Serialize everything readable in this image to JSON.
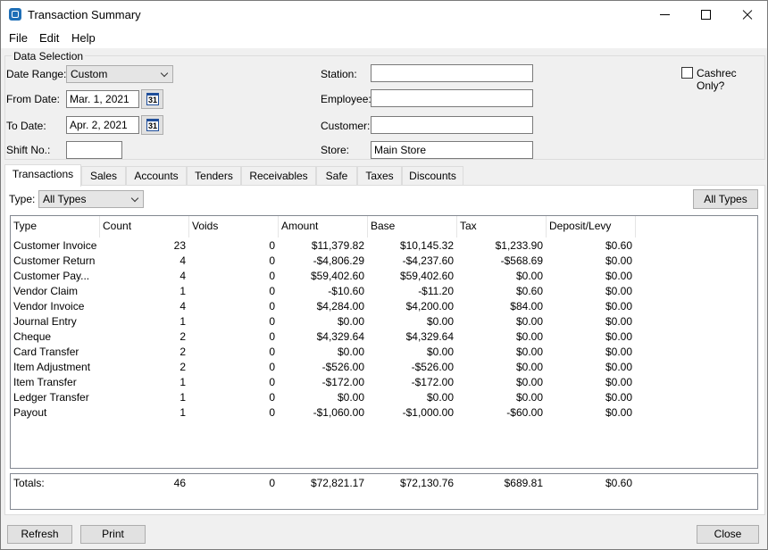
{
  "window": {
    "title": "Transaction Summary"
  },
  "menu": {
    "file": "File",
    "edit": "Edit",
    "help": "Help"
  },
  "data_selection": {
    "title": "Data Selection",
    "date_range_label": "Date Range:",
    "date_range_value": "Custom",
    "from_date_label": "From Date:",
    "from_date_value": "Mar. 1, 2021",
    "to_date_label": "To Date:",
    "to_date_value": "Apr. 2, 2021",
    "shift_label": "Shift No.:",
    "shift_value": "",
    "station_label": "Station:",
    "station_value": "",
    "employee_label": "Employee:",
    "employee_value": "",
    "customer_label": "Customer:",
    "customer_value": "",
    "store_label": "Store:",
    "store_value": "Main Store",
    "cashrec_label": "Cashrec Only?",
    "calendar_glyph": "31"
  },
  "tabs": [
    "Transactions",
    "Sales",
    "Accounts",
    "Tenders",
    "Receivables",
    "Safe",
    "Taxes",
    "Discounts"
  ],
  "filter": {
    "type_label": "Type:",
    "type_value": "All Types",
    "all_types_button": "All Types"
  },
  "grid": {
    "headers": [
      "Type",
      "Count",
      "Voids",
      "Amount",
      "Base",
      "Tax",
      "Deposit/Levy"
    ],
    "rows": [
      [
        "Customer Invoice",
        "23",
        "0",
        "$11,379.82",
        "$10,145.32",
        "$1,233.90",
        "$0.60"
      ],
      [
        "Customer Return",
        "4",
        "0",
        "-$4,806.29",
        "-$4,237.60",
        "-$568.69",
        "$0.00"
      ],
      [
        "Customer Pay...",
        "4",
        "0",
        "$59,402.60",
        "$59,402.60",
        "$0.00",
        "$0.00"
      ],
      [
        "Vendor Claim",
        "1",
        "0",
        "-$10.60",
        "-$11.20",
        "$0.60",
        "$0.00"
      ],
      [
        "Vendor Invoice",
        "4",
        "0",
        "$4,284.00",
        "$4,200.00",
        "$84.00",
        "$0.00"
      ],
      [
        "Journal Entry",
        "1",
        "0",
        "$0.00",
        "$0.00",
        "$0.00",
        "$0.00"
      ],
      [
        "Cheque",
        "2",
        "0",
        "$4,329.64",
        "$4,329.64",
        "$0.00",
        "$0.00"
      ],
      [
        "Card Transfer",
        "2",
        "0",
        "$0.00",
        "$0.00",
        "$0.00",
        "$0.00"
      ],
      [
        "Item Adjustment",
        "2",
        "0",
        "-$526.00",
        "-$526.00",
        "$0.00",
        "$0.00"
      ],
      [
        "Item Transfer",
        "1",
        "0",
        "-$172.00",
        "-$172.00",
        "$0.00",
        "$0.00"
      ],
      [
        "Ledger Transfer",
        "1",
        "0",
        "$0.00",
        "$0.00",
        "$0.00",
        "$0.00"
      ],
      [
        "Payout",
        "1",
        "0",
        "-$1,060.00",
        "-$1,000.00",
        "-$60.00",
        "$0.00"
      ]
    ]
  },
  "totals": [
    "Totals:",
    "46",
    "0",
    "$72,821.17",
    "$72,130.76",
    "$689.81",
    "$0.60"
  ],
  "buttons": {
    "refresh": "Refresh",
    "print": "Print",
    "close": "Close"
  }
}
